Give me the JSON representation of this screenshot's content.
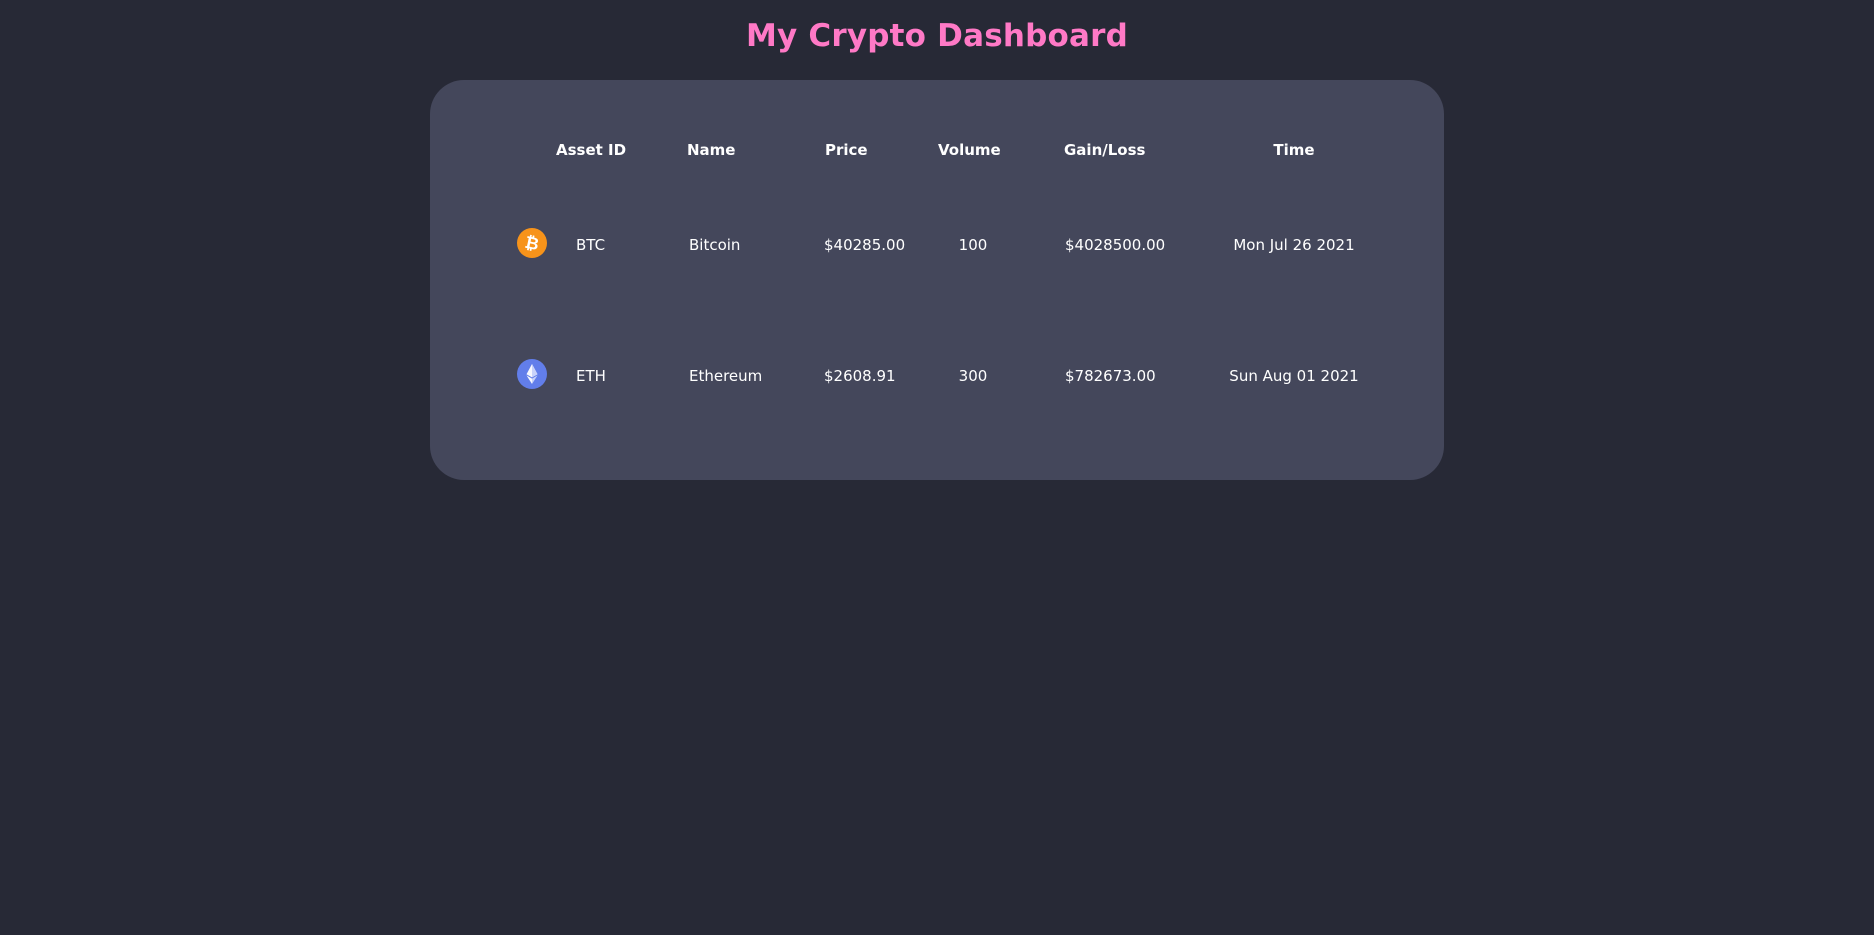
{
  "header": {
    "title": "My Crypto Dashboard"
  },
  "table": {
    "columns": [
      "Asset ID",
      "Name",
      "Price",
      "Volume",
      "Gain/Loss",
      "Time"
    ],
    "rows": [
      {
        "icon": "bitcoin-icon",
        "icon_color": "#f7931a",
        "asset_id": "BTC",
        "name": "Bitcoin",
        "price": "$40285.00",
        "volume": "100",
        "gain_loss": "$4028500.00",
        "time": "Mon Jul 26 2021"
      },
      {
        "icon": "ethereum-icon",
        "icon_color": "#627eea",
        "asset_id": "ETH",
        "name": "Ethereum",
        "price": "$2608.91",
        "volume": "300",
        "gain_loss": "$782673.00",
        "time": "Sun Aug 01 2021"
      }
    ]
  },
  "colors": {
    "background": "#272936",
    "card": "#44475b",
    "title": "#ff79c6",
    "text": "#ffffff"
  }
}
